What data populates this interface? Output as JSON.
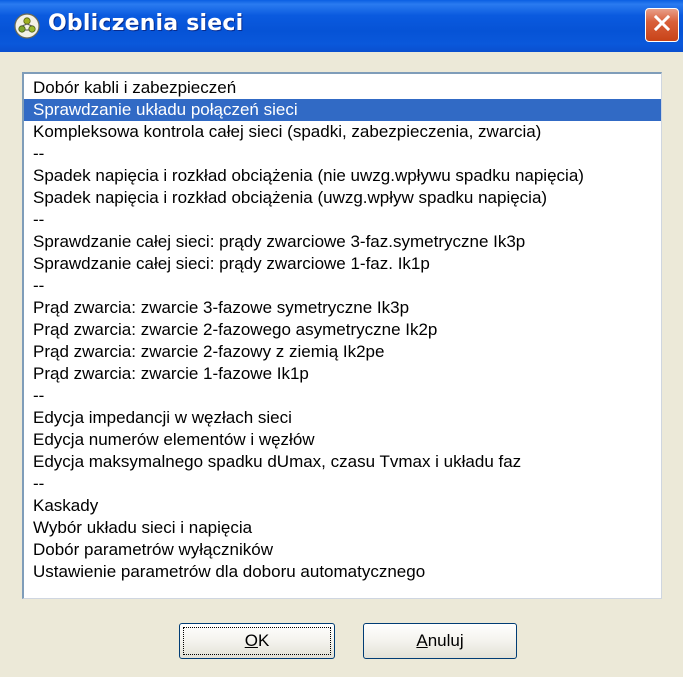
{
  "window": {
    "title": "Obliczenia sieci"
  },
  "list": {
    "selected_index": 1,
    "items": [
      "Dobór kabli i zabezpieczeń",
      "Sprawdzanie układu połączeń sieci",
      "Kompleksowa kontrola całej sieci (spadki, zabezpieczenia, zwarcia)",
      "--",
      "Spadek napięcia i rozkład obciążenia (nie uwzg.wpływu spadku napięcia)",
      "Spadek napięcia i rozkład obciążenia (uwzg.wpływ spadku napięcia)",
      "--",
      "Sprawdzanie całej sieci: prądy zwarciowe 3-faz.symetryczne Ik3p",
      "Sprawdzanie całej sieci: prądy zwarciowe 1-faz. Ik1p",
      "--",
      "Prąd zwarcia: zwarcie 3-fazowe symetryczne Ik3p",
      "Prąd zwarcia: zwarcie 2-fazowego asymetryczne Ik2p",
      "Prąd zwarcia: zwarcie 2-fazowy z ziemią Ik2pe",
      "Prąd zwarcia: zwarcie 1-fazowe Ik1p",
      "--",
      "Edycja impedancji w węzłach sieci",
      "Edycja numerów elementów i węzłów",
      "Edycja maksymalnego spadku dUmax, czasu Tvmax i układu faz",
      "--",
      "Kaskady",
      "Wybór układu sieci i napięcia",
      "Dobór parametrów wyłączników",
      "Ustawienie parametrów dla doboru automatycznego"
    ]
  },
  "buttons": {
    "ok": {
      "mnemonic": "O",
      "rest": "K"
    },
    "cancel": {
      "mnemonic": "A",
      "rest": "nuluj"
    }
  },
  "colors": {
    "selection": "#316ac5",
    "titlebar": "#0a58db",
    "close_button": "#d9603a",
    "dialog_background": "#ece9d8"
  },
  "icons": {
    "app": "app-icon",
    "close": "close-icon"
  }
}
